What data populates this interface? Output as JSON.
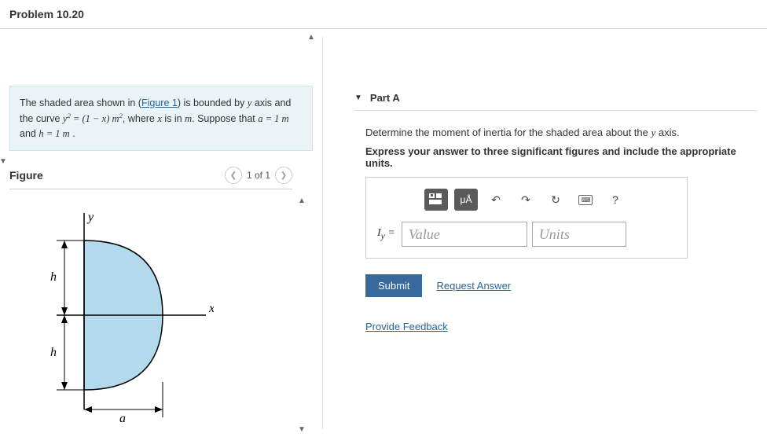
{
  "header": {
    "title": "Problem 10.20"
  },
  "problem": {
    "text_pre": "The shaded area shown in (",
    "figure_link": "Figure 1",
    "text_post": ") is bounded by ",
    "var_y": "y",
    "text2": " axis and the curve ",
    "equation_html": "y² = (1 − x) m²",
    "text3": ", where ",
    "var_x": "x",
    "text4": " is in ",
    "unit_m": "m",
    "text5": ". Suppose that ",
    "cond1": "a = 1  m",
    "text6": " and ",
    "cond2": "h = 1  m",
    "text7": " ."
  },
  "figure": {
    "label": "Figure",
    "pager": "1 of 1",
    "axis_y": "y",
    "axis_x": "x",
    "dim_h": "h",
    "dim_a": "a"
  },
  "partA": {
    "label": "Part A",
    "instruction1_pre": "Determine the moment of inertia for the shaded area about the ",
    "instruction1_var": "y",
    "instruction1_post": " axis.",
    "instruction2": "Express your answer to three significant figures and include the appropriate units.",
    "var_label_html": "I<sub>y</sub> =",
    "value_placeholder": "Value",
    "units_placeholder": "Units",
    "submit": "Submit",
    "request": "Request Answer",
    "toolbar_units": "μÅ",
    "toolbar_help": "?"
  },
  "feedback": {
    "label": "Provide Feedback"
  }
}
